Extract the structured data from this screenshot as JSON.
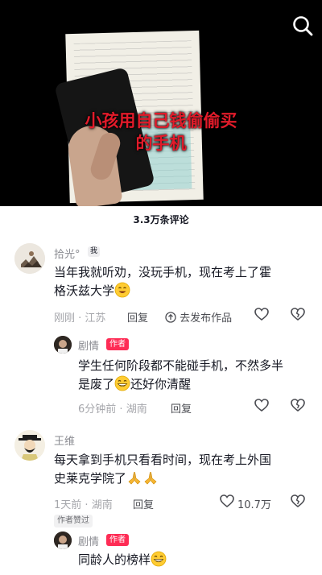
{
  "video": {
    "caption_line1": "小孩用自己钱偷偷买",
    "caption_line2": "的手机"
  },
  "comments_header": {
    "count_label": "3.3万条评论"
  },
  "comments": [
    {
      "username": "拾光°",
      "badge": "我",
      "text_line1": "当年我就听劝，没玩手机，现在考上了霍",
      "text_line2": "格沃兹大学",
      "time": "刚刚",
      "location": "江苏",
      "reply_label": "回复",
      "share_label": "去发布作品"
    },
    {
      "username": "剧情",
      "badge": "作者",
      "text_line1": "学生任何阶段都不能碰手机，不然多半",
      "text_line2": "是废了",
      "text_line2_suffix": "还好你清醒",
      "time": "6分钟前",
      "location": "湖南",
      "reply_label": "回复"
    },
    {
      "username": "王维",
      "text_line1": "每天拿到手机只看看时间，现在考上外国",
      "text_line2": "史莱克学院了",
      "time": "1天前",
      "location": "湖南",
      "reply_label": "回复",
      "like_count": "10.7万",
      "liked_by_author_label": "作者赞过"
    },
    {
      "username": "剧情",
      "badge": "作者",
      "text_line1": "同龄人的榜样"
    }
  ],
  "colors": {
    "accent": "#fe2c55",
    "caption": "#e21b2a",
    "text": "#161823",
    "meta": "#a5a6ab"
  }
}
